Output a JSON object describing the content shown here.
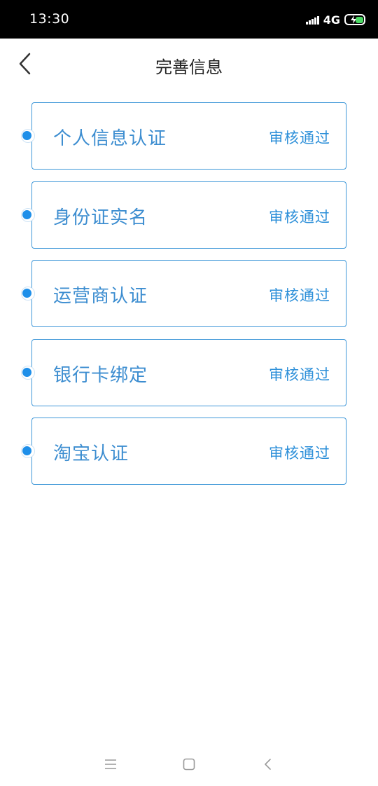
{
  "status_bar": {
    "time": "13:30",
    "network": "4G",
    "battery_color": "#4cd964"
  },
  "header": {
    "title": "完善信息",
    "back_icon": "chevron-left-icon"
  },
  "colors": {
    "accent": "#1e8fe9",
    "card_border": "#3e97d8",
    "label": "#3c8dd0"
  },
  "items": [
    {
      "label": "个人信息认证",
      "status": "审核通过"
    },
    {
      "label": "身份证实名",
      "status": "审核通过"
    },
    {
      "label": "运营商认证",
      "status": "审核通过"
    },
    {
      "label": "银行卡绑定",
      "status": "审核通过"
    },
    {
      "label": "淘宝认证",
      "status": "审核通过"
    }
  ],
  "nav_bar": {
    "icons": [
      "menu-icon",
      "home-icon",
      "back-icon"
    ]
  }
}
